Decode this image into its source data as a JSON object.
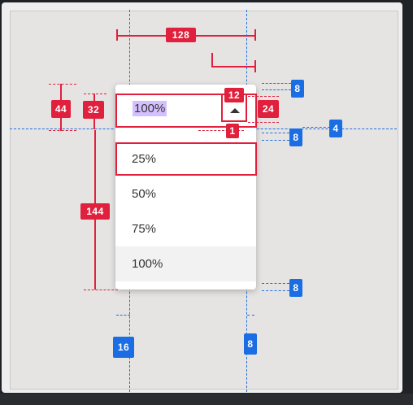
{
  "spec": {
    "options": [
      "25%",
      "50%",
      "75%",
      "100%"
    ],
    "selected_value": "100%",
    "labels_red": {
      "menu_width": "128",
      "field_height": "44",
      "input_height": "32",
      "list_height": "144",
      "icon_width": "12",
      "icon_height": "24",
      "divider": "1"
    },
    "labels_blue": {
      "top_right": "8",
      "mid_right": "8",
      "far_right": "4",
      "bottom_right": "8",
      "left_padding": "16",
      "right_padding": "8"
    },
    "colors": {
      "spec_red": "#e0203c",
      "guide_blue": "#1a6de3",
      "selection": "#d4c0ff",
      "hover": "#f2f2f2"
    }
  }
}
